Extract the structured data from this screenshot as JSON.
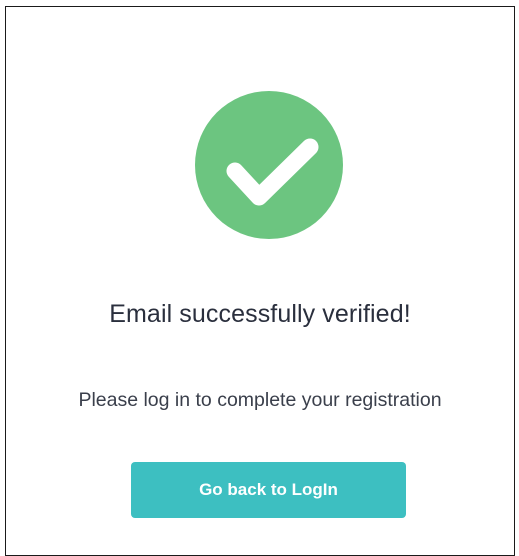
{
  "icon": {
    "name": "check-circle-icon",
    "color": "#6cc580"
  },
  "message": {
    "title": "Email successfully verified!",
    "subtitle": "Please log in to complete your registration"
  },
  "action": {
    "label": "Go back to LogIn",
    "color": "#3dbfc1"
  }
}
